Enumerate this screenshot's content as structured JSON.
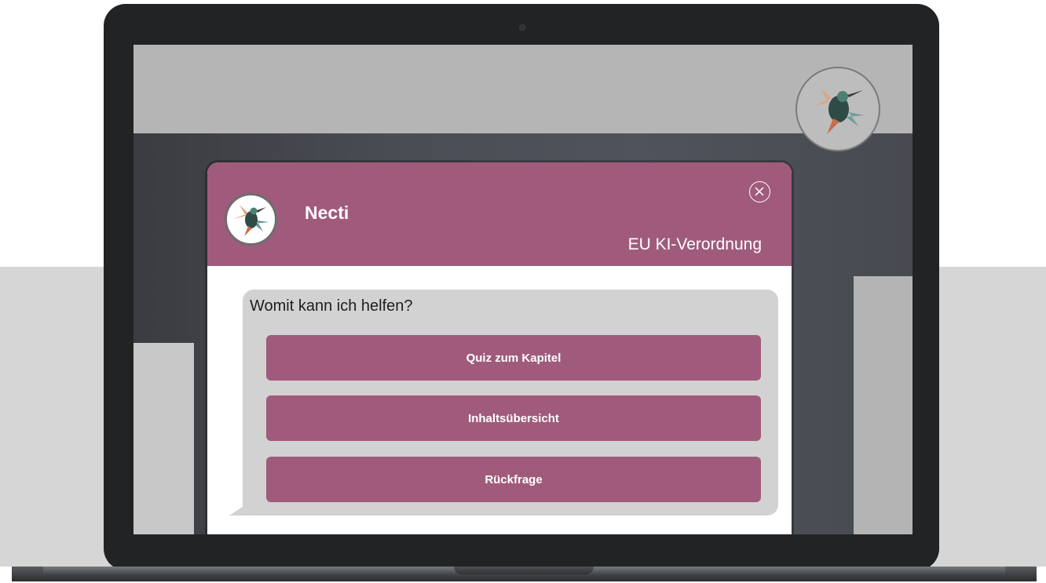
{
  "chat": {
    "bot_name": "Necti",
    "subject": "EU KI-Verordnung",
    "question": "Womit kann ich helfen?",
    "options": [
      {
        "label": "Quiz zum Kapitel"
      },
      {
        "label": "Inhaltsübersicht"
      },
      {
        "label": "Rückfrage"
      }
    ]
  },
  "icons": {
    "launcher": "hummingbird-icon",
    "avatar": "hummingbird-icon",
    "close": "close-circle-icon"
  },
  "colors": {
    "accent": "#a05b7c",
    "bubble": "#d2d2d2",
    "header_text": "#ffffff"
  }
}
